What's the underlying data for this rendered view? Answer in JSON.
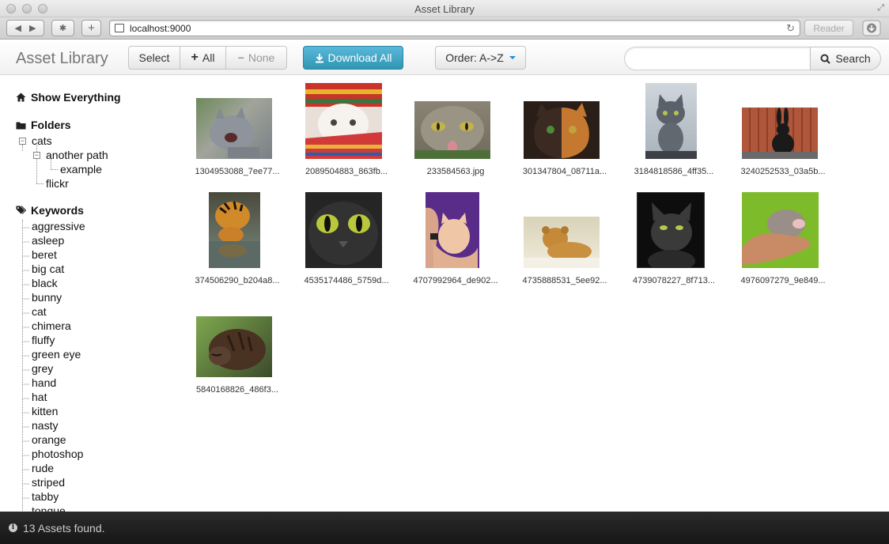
{
  "window": {
    "title": "Asset Library"
  },
  "browser": {
    "url": "localhost:9000",
    "reader_label": "Reader"
  },
  "navbar": {
    "brand": "Asset Library",
    "select_label": "Select",
    "all_label": "All",
    "none_label": "None",
    "download_all_label": "Download All",
    "order_label": "Order: A->Z",
    "search_placeholder": "",
    "search_label": "Search",
    "accent_color": "#2f96b4"
  },
  "sidebar": {
    "show_everything": "Show Everything",
    "folders_title": "Folders",
    "folders": {
      "cats": "cats",
      "another_path": "another path",
      "example": "example",
      "flickr": "flickr"
    },
    "keywords_title": "Keywords",
    "keywords": [
      "aggressive",
      "asleep",
      "beret",
      "big cat",
      "black",
      "bunny",
      "cat",
      "chimera",
      "fluffy",
      "green eye",
      "grey",
      "hand",
      "hat",
      "kitten",
      "nasty",
      "orange",
      "photoshop",
      "rude",
      "striped",
      "tabby",
      "tongue"
    ]
  },
  "assets": [
    {
      "name": "1304953088_7ee77...",
      "icon": "grey-cat-hissing"
    },
    {
      "name": "2089504883_863fb...",
      "icon": "white-cat-in-hat"
    },
    {
      "name": "233584563.jpg",
      "icon": "tabby-cat-tongue"
    },
    {
      "name": "301347804_08711a...",
      "icon": "chimera-cat"
    },
    {
      "name": "3184818586_4ff35...",
      "icon": "grey-kitten"
    },
    {
      "name": "3240252533_03a5b...",
      "icon": "black-bunny"
    },
    {
      "name": "374506290_b204a8...",
      "icon": "tiger-drinking"
    },
    {
      "name": "4535174486_5759d...",
      "icon": "black-cat-green-eyes"
    },
    {
      "name": "4707992964_de902...",
      "icon": "kitten-in-hand"
    },
    {
      "name": "4735888531_5ee92...",
      "icon": "lion-cub"
    },
    {
      "name": "4739078227_8f713...",
      "icon": "black-cat-portrait"
    },
    {
      "name": "4976097279_9e849...",
      "icon": "newborn-kitten-hand"
    },
    {
      "name": "5840168826_486f3...",
      "icon": "sleeping-cat"
    }
  ],
  "status": {
    "text": "13 Assets found."
  }
}
